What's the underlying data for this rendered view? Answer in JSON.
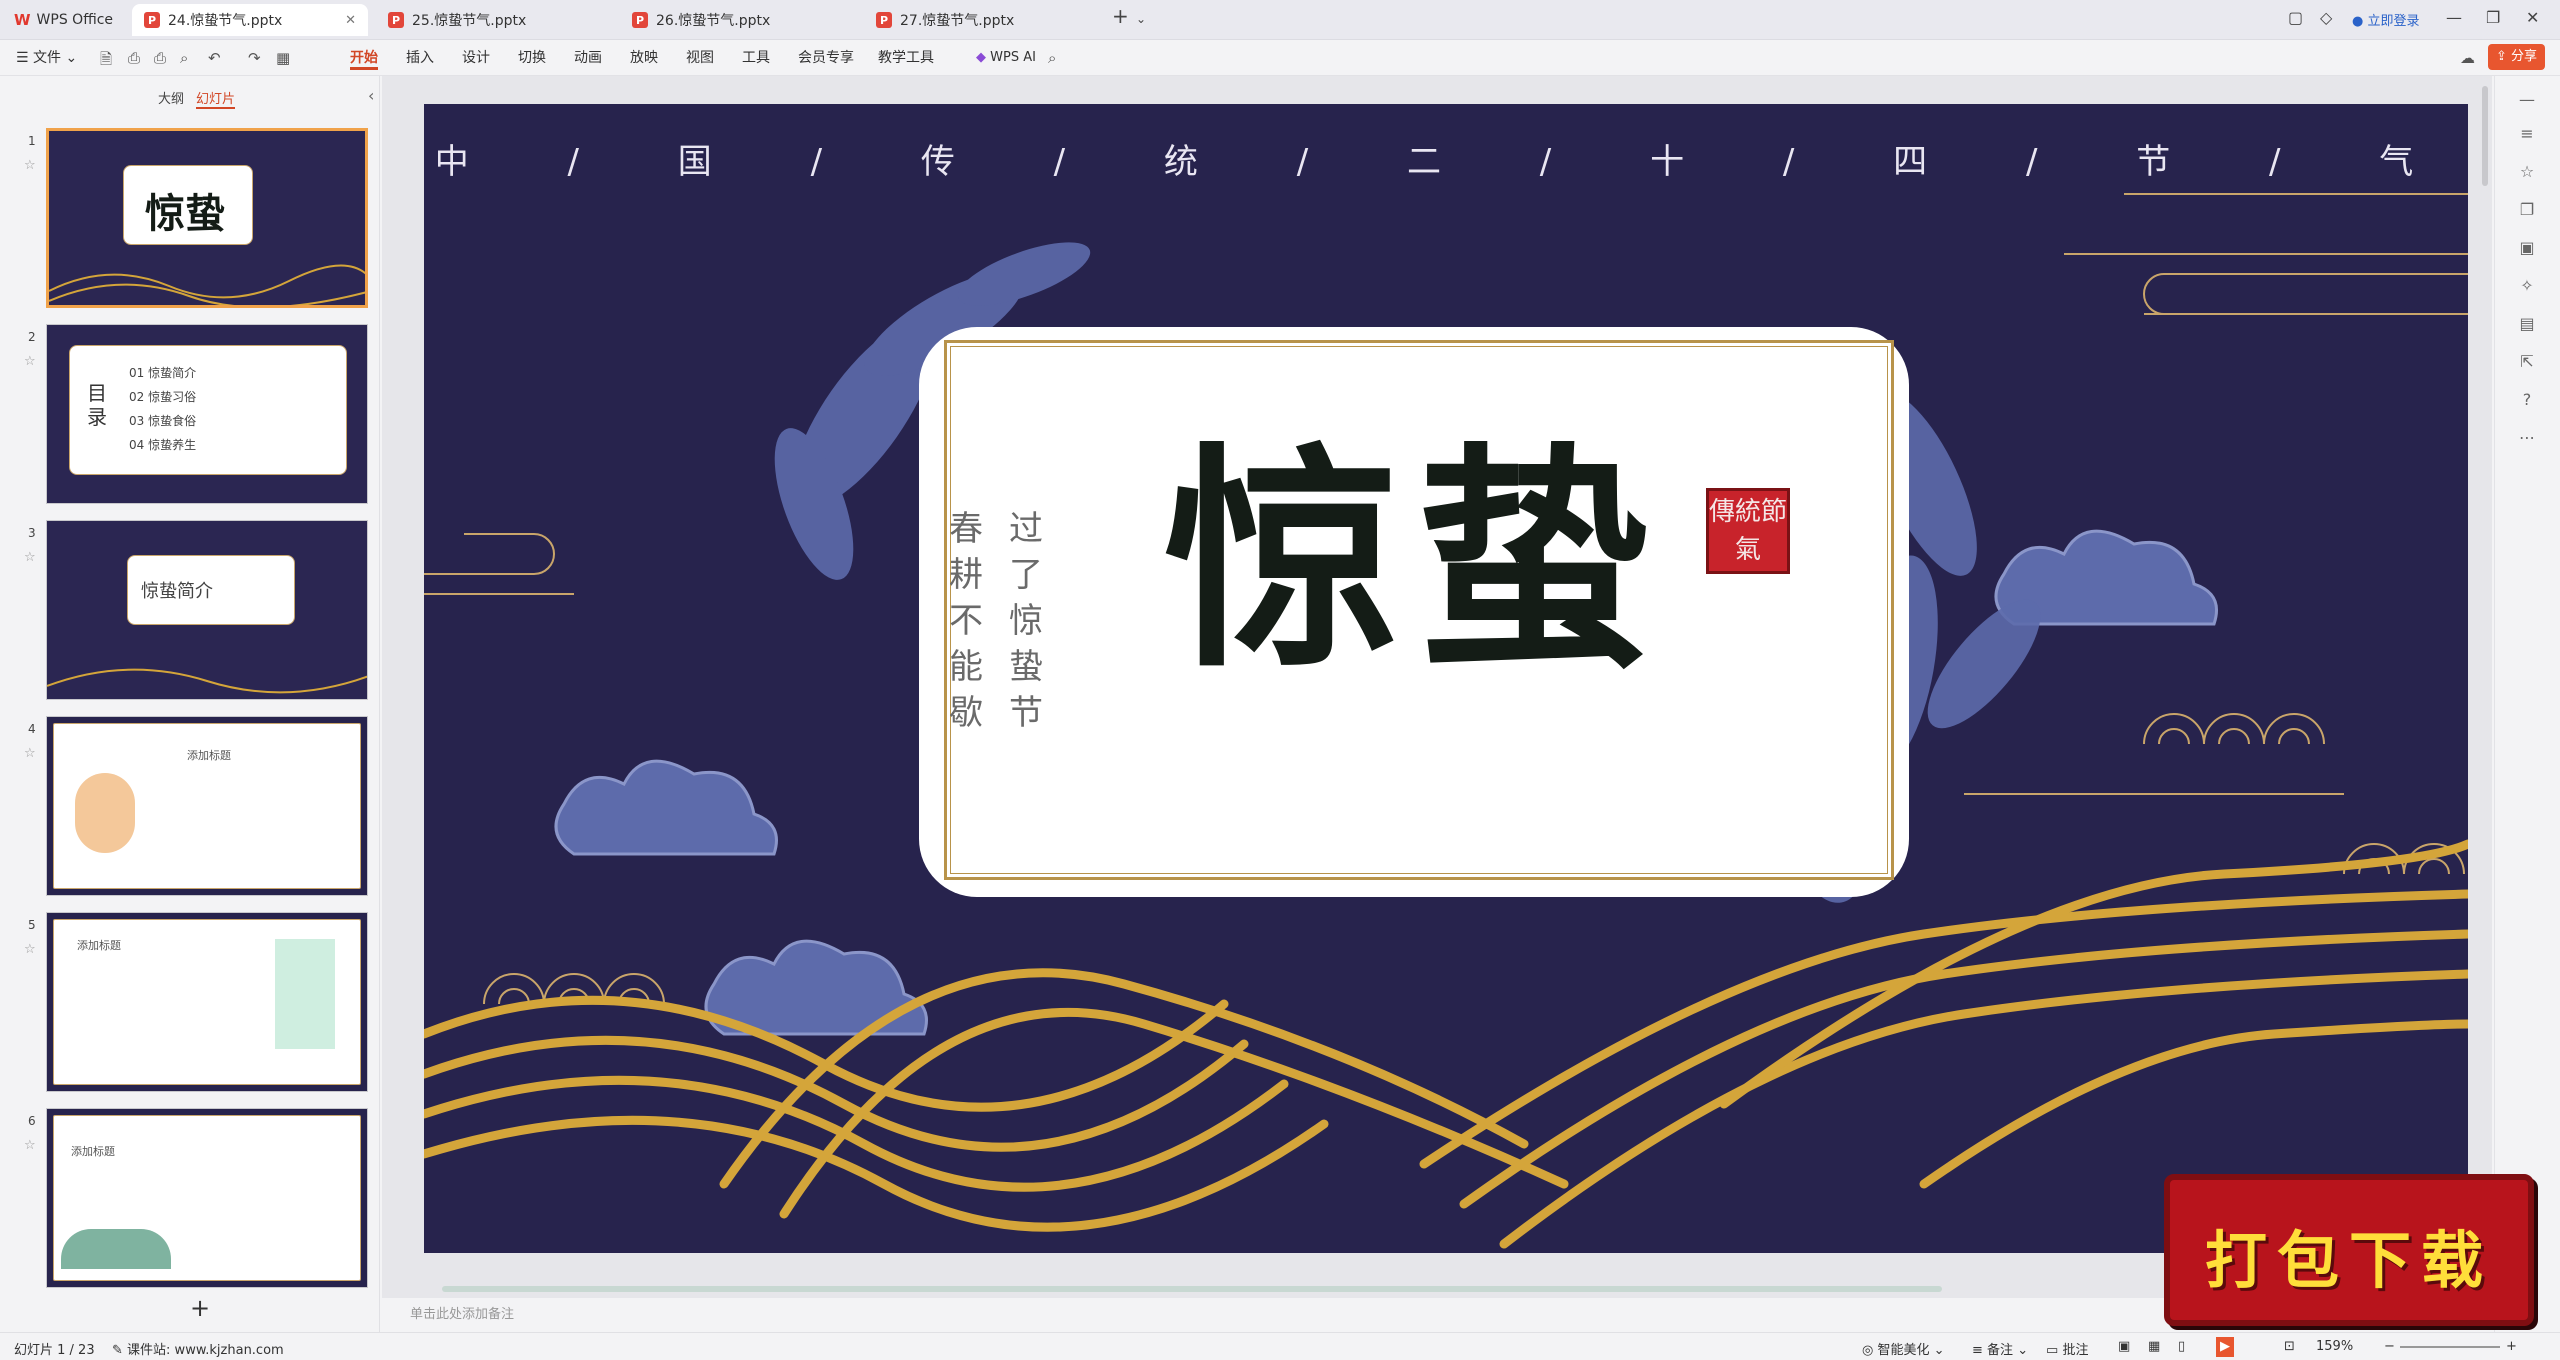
{
  "app": {
    "name": "WPS Office"
  },
  "tabs": [
    {
      "label": "24.惊蛰节气.pptx",
      "active": true
    },
    {
      "label": "25.惊蛰节气.pptx",
      "active": false
    },
    {
      "label": "26.惊蛰节气.pptx",
      "active": false
    },
    {
      "label": "27.惊蛰节气.pptx",
      "active": false
    }
  ],
  "window": {
    "login": "立即登录",
    "share": "分享"
  },
  "ribbon": {
    "file": "文件",
    "menus": [
      "开始",
      "插入",
      "设计",
      "切换",
      "动画",
      "放映",
      "视图",
      "工具",
      "会员专享",
      "教学工具"
    ],
    "ai": "WPS AI"
  },
  "sidebar": {
    "tab_outline": "大纲",
    "tab_slides": "幻灯片",
    "slides": [
      {
        "num": "1",
        "title": "惊蛰"
      },
      {
        "num": "2",
        "title": "目录",
        "items": [
          {
            "n": "01",
            "t": "惊蛰简介"
          },
          {
            "n": "02",
            "t": "惊蛰习俗"
          },
          {
            "n": "03",
            "t": "惊蛰食俗"
          },
          {
            "n": "04",
            "t": "惊蛰养生"
          }
        ]
      },
      {
        "num": "3",
        "title": "惊蛰简介"
      },
      {
        "num": "4",
        "title": "添加标题"
      },
      {
        "num": "5",
        "title": "添加标题"
      },
      {
        "num": "6",
        "title": "添加标题"
      }
    ],
    "add": "+"
  },
  "slide": {
    "topline": "中 / 国 / 传 / 统 / 二 / 十 / 四 / 节 / 气",
    "char1": "惊",
    "char2": "蛰",
    "vcol1": "春耕不能歇",
    "vcol2": "过了惊蛰节",
    "seal": "傳統節氣"
  },
  "notes_placeholder": "单击此处添加备注",
  "status": {
    "slide_count": "幻灯片 1 / 23",
    "source": "课件站: www.kjzhan.com",
    "beautify": "智能美化",
    "notes": "备注",
    "comment": "批注",
    "zoom": "159%"
  },
  "download_banner": "打包下载",
  "colors": {
    "slide_bg": "#27234d",
    "accent": "#d24726",
    "gold": "#d4a53a",
    "leaf": "#5d6bab"
  }
}
